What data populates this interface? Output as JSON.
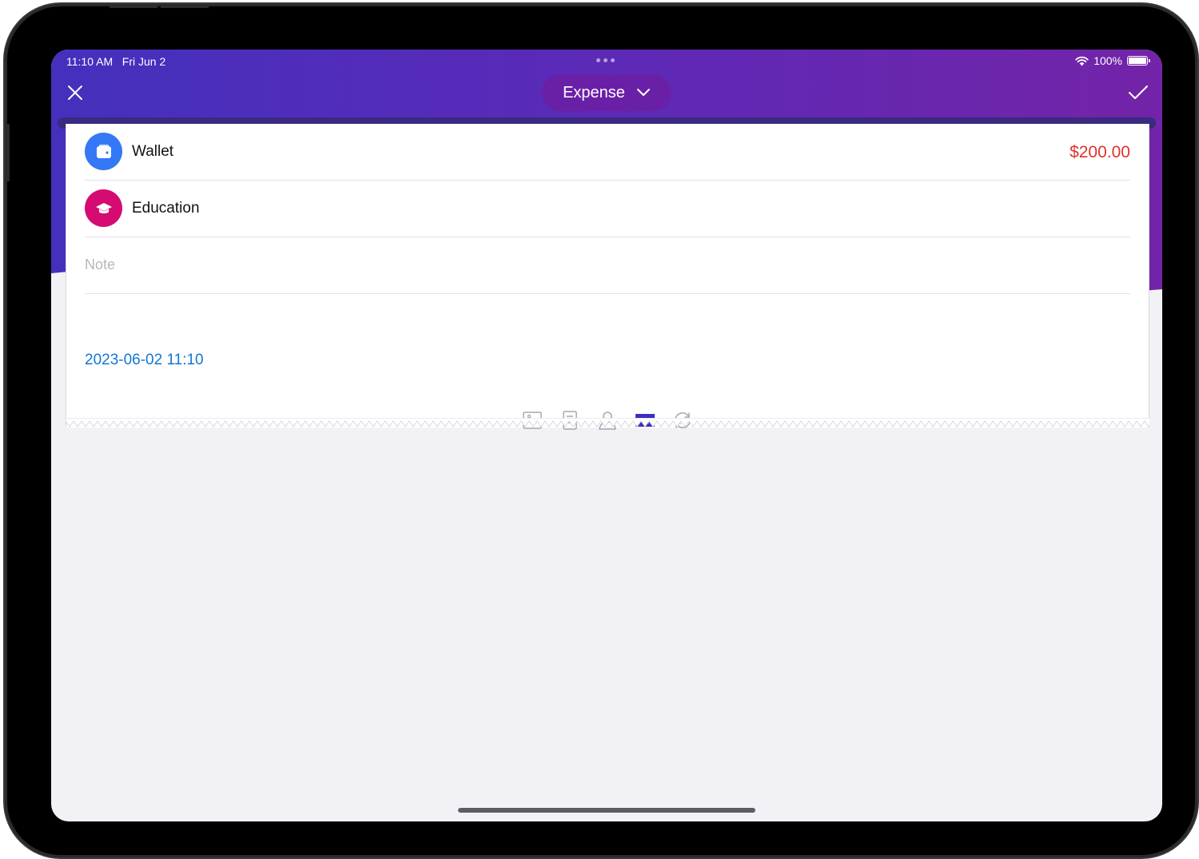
{
  "status_bar": {
    "time": "11:10 AM",
    "date": "Fri Jun 2",
    "battery": "100%"
  },
  "header": {
    "transaction_type": "Expense",
    "accent_gradient": [
      "#4430bd",
      "#7324a8"
    ],
    "pill_color": "#6a20a6"
  },
  "form": {
    "account": {
      "label": "Wallet",
      "icon": "wallet-icon",
      "color": "#3478f6"
    },
    "amount": {
      "value": "$200.00",
      "color": "#e0322b"
    },
    "category": {
      "label": "Education",
      "icon": "graduation-cap-icon",
      "color": "#d60b72"
    },
    "note": {
      "placeholder": "Note",
      "value": ""
    },
    "datetime": "2023-06-02 11:10"
  },
  "toolbar": {
    "items": [
      "image-icon",
      "document-icon",
      "person-icon",
      "event-ticket-icon",
      "repeat-icon"
    ],
    "active": "event-ticket-icon",
    "active_color": "#3a2fc0",
    "inactive_color": "#a7a7ad"
  }
}
